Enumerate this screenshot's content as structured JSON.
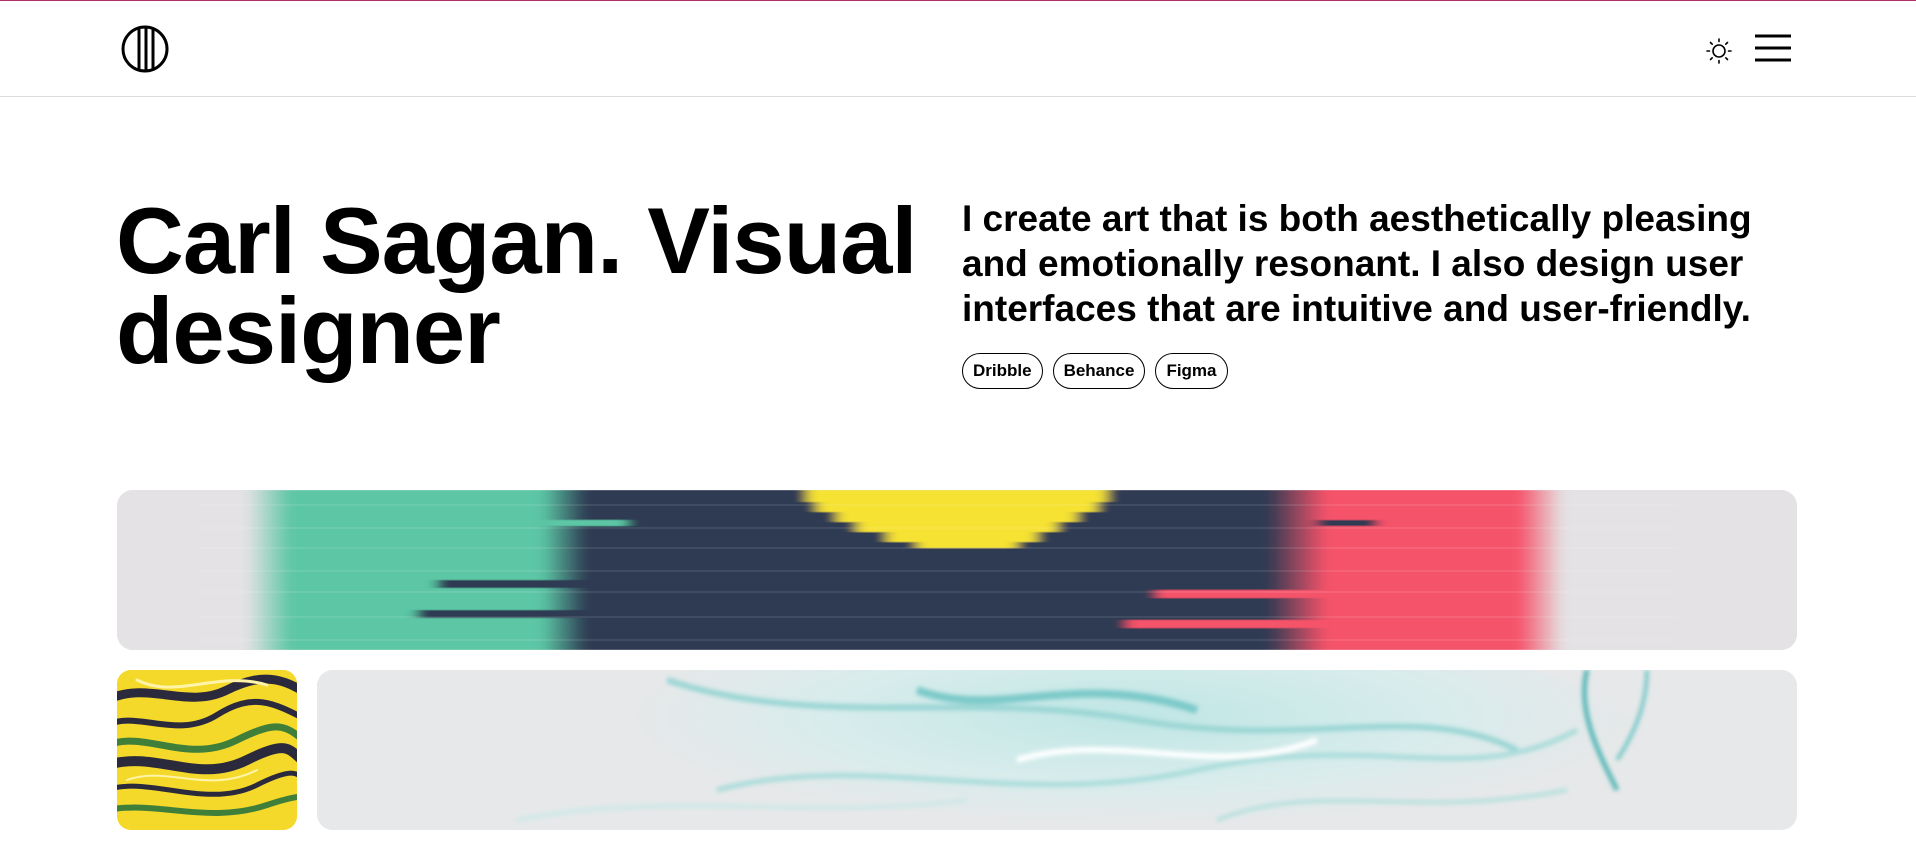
{
  "header": {
    "logo_icon": "circle-stripes-logo-icon",
    "theme_icon": "sun-icon",
    "menu_icon": "hamburger-menu-icon"
  },
  "hero": {
    "title": "Carl Sagan. Visual designer",
    "description": "I create art that is both aesthetically pleasing and emotionally resonant. I also design user interfaces that are intuitive and user-friendly.",
    "links": [
      {
        "label": "Dribble"
      },
      {
        "label": "Behance"
      },
      {
        "label": "Figma"
      }
    ]
  },
  "gallery": {
    "images": [
      {
        "name": "streaked-color-banner",
        "colors": [
          "#5cc6a5",
          "#2d3a52",
          "#f6e233",
          "#f5536a"
        ]
      },
      {
        "name": "yellow-marble-thumbnail",
        "colors": [
          "#f5d92a",
          "#2b2a3d",
          "#3f7f3a"
        ]
      },
      {
        "name": "teal-glass-swirl-image",
        "colors": [
          "#e6e8e9",
          "#9ad6d4",
          "#7cc9c9"
        ]
      }
    ]
  },
  "colors": {
    "accent_line": "#b3316b",
    "text": "#000000",
    "background": "#ffffff"
  }
}
